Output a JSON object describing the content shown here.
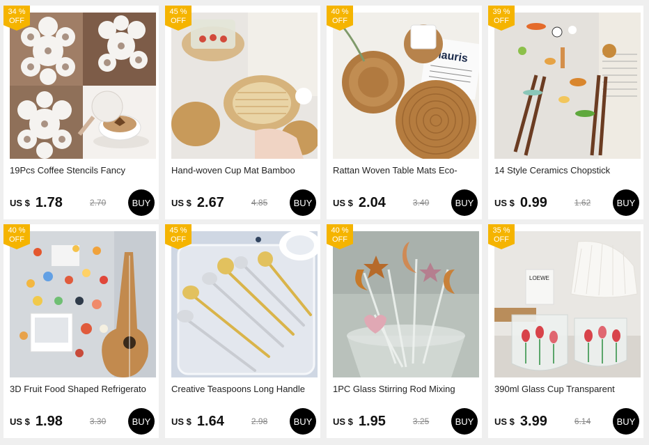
{
  "products": [
    {
      "discount_num": "34 %",
      "discount_word": "OFF",
      "title": "19Pcs Coffee Stencils Fancy",
      "currency": "US $",
      "price": "1.78",
      "old_price": "2.70",
      "buy_label": "BUY",
      "image": "coffee-stencils-photo"
    },
    {
      "discount_num": "45 %",
      "discount_word": "OFF",
      "title": "Hand-woven Cup Mat Bamboo",
      "currency": "US $",
      "price": "2.67",
      "old_price": "4.85",
      "buy_label": "BUY",
      "image": "woven-cup-mat-photo"
    },
    {
      "discount_num": "40 %",
      "discount_word": "OFF",
      "title": "Rattan Woven Table Mats Eco-",
      "currency": "US $",
      "price": "2.04",
      "old_price": "3.40",
      "buy_label": "BUY",
      "image": "rattan-table-mats-photo"
    },
    {
      "discount_num": "39 %",
      "discount_word": "OFF",
      "title": "14 Style Ceramics Chopstick",
      "currency": "US $",
      "price": "0.99",
      "old_price": "1.62",
      "buy_label": "BUY",
      "image": "ceramic-chopstick-rest-photo"
    },
    {
      "discount_num": "40 %",
      "discount_word": "OFF",
      "title": "3D Fruit Food Shaped Refrigerato",
      "currency": "US $",
      "price": "1.98",
      "old_price": "3.30",
      "buy_label": "BUY",
      "image": "fridge-magnets-photo"
    },
    {
      "discount_num": "45 %",
      "discount_word": "OFF",
      "title": "Creative Teaspoons Long Handle",
      "currency": "US $",
      "price": "1.64",
      "old_price": "2.98",
      "buy_label": "BUY",
      "image": "teaspoons-photo"
    },
    {
      "discount_num": "40 %",
      "discount_word": "OFF",
      "title": "1PC Glass Stirring Rod Mixing",
      "currency": "US $",
      "price": "1.95",
      "old_price": "3.25",
      "buy_label": "BUY",
      "image": "glass-stirring-rods-photo"
    },
    {
      "discount_num": "35 %",
      "discount_word": "OFF",
      "title": "390ml Glass Cup Transparent",
      "currency": "US $",
      "price": "3.99",
      "old_price": "6.14",
      "buy_label": "BUY",
      "image": "glass-cups-photo"
    }
  ],
  "image_text": {
    "newspaper": "Mauris",
    "book": "LOEWE"
  },
  "colors": {
    "badge": "#f5b400",
    "buy_button": "#000000",
    "page_background": "#efefef"
  }
}
